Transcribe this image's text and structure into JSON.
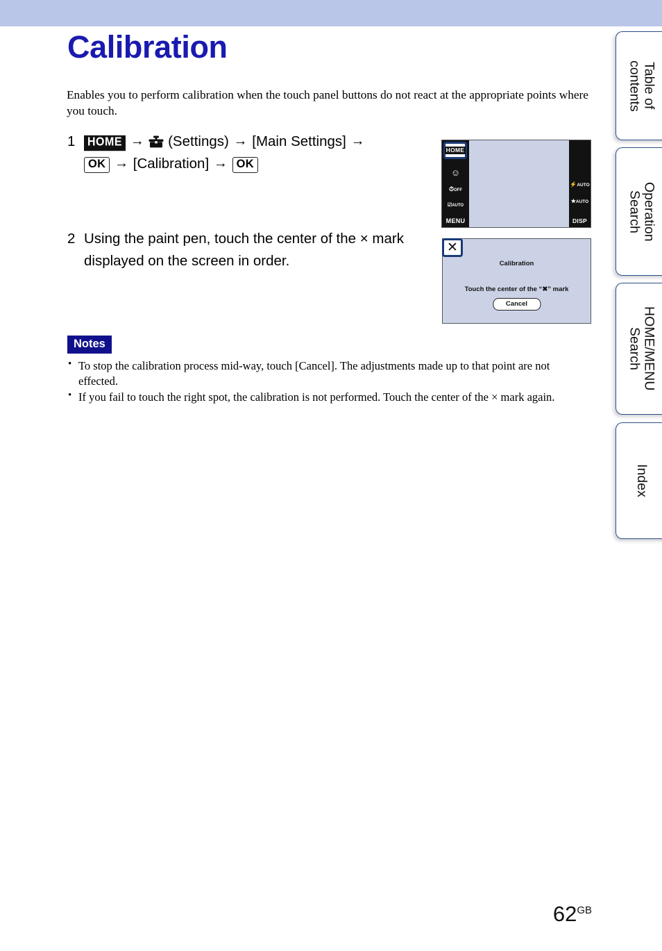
{
  "page": {
    "title": "Calibration",
    "title_color": "#1a1ab0",
    "top_band_color": "#bac6e8",
    "number": "62",
    "number_suffix": "GB"
  },
  "intro": "Enables you to perform calibration when the touch panel buttons do not react at the appropriate points where you touch.",
  "steps": [
    {
      "number": "1",
      "line1_parts": {
        "home_icon": "HOME",
        "arrow": "→",
        "toolbox_icon": "toolbox-icon",
        "settings": "(Settings)",
        "main_settings": "[Main Settings]"
      },
      "line2_parts": {
        "ok_icon": "OK",
        "calibration": "[Calibration]",
        "ok_icon_2": "OK"
      }
    },
    {
      "number": "2",
      "text": "Using the paint pen, touch the center of the × mark displayed on the screen in order."
    }
  ],
  "illustrations": {
    "camera_screen": {
      "home_button": "HOME",
      "left_icons": [
        "smile-icon",
        "self-timer-off-icon",
        "flash-auto-icon",
        "MENU"
      ],
      "left_menu_label": "MENU",
      "right_icons": [
        "flash-auto-icon",
        "macro-auto-icon"
      ],
      "right_disp_label": "DISP",
      "flash_label": "AUTO",
      "macro_label": "AUTO"
    },
    "calibration_screen": {
      "close_icon": "✕",
      "title": "Calibration",
      "message": "Touch the center of the “✖” mark",
      "cancel_button": "Cancel"
    }
  },
  "notes": {
    "label": "Notes",
    "items": [
      "To stop the calibration process mid-way, touch [Cancel]. The adjustments made up to that point are not effected.",
      "If you fail to touch the right spot, the calibration is not performed. Touch the center of the × mark again."
    ],
    "bullet": "•"
  },
  "tabs": [
    {
      "label": "Table of\ncontents"
    },
    {
      "label": "Operation\nSearch"
    },
    {
      "label": "HOME/MENU\nSearch"
    },
    {
      "label": "Index"
    }
  ]
}
